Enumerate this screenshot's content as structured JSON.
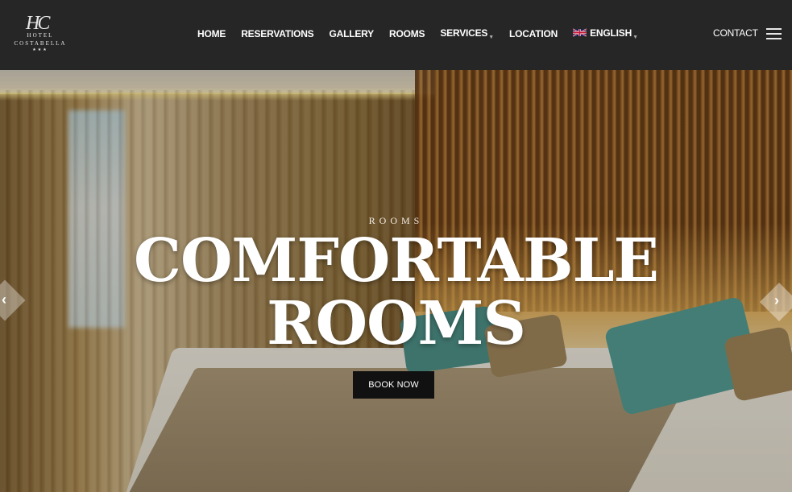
{
  "logo": {
    "monogram": "HC",
    "line1": "HOTEL",
    "line2": "COSTABELLA",
    "stars": "★★★"
  },
  "nav": {
    "items": [
      {
        "label": "HOME"
      },
      {
        "label": "RESERVATIONS"
      },
      {
        "label": "GALLERY"
      },
      {
        "label": "ROOMS"
      },
      {
        "label": "SERVICES"
      },
      {
        "label": "LOCATION"
      },
      {
        "label": "ENGLISH"
      }
    ],
    "contact": "CONTACT"
  },
  "hero": {
    "subtitle": "ROOMS",
    "title_line1": "COMFORTABLE",
    "title_line2": "ROOMS",
    "button": "BOOK NOW"
  },
  "icons": {
    "menu": "hamburger-icon",
    "flag": "uk-flag-icon",
    "prev": "chevron-left-icon",
    "next": "chevron-right-icon"
  }
}
